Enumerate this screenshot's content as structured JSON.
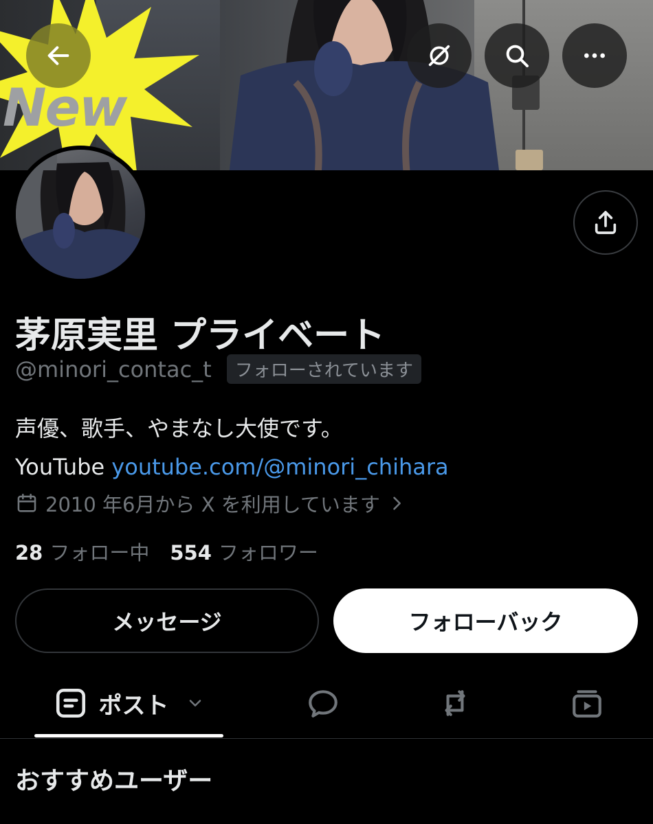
{
  "banner": {
    "sticker_text": "New"
  },
  "profile": {
    "name": "茅原実里 プライベート",
    "handle": "@minori_contac_t",
    "follows_you": "フォローされています",
    "bio_line1": "声優、歌手、やまなし大使です。",
    "bio_line2_prefix": "YouTube ",
    "bio_link": "youtube.com/@minori_chihara",
    "joined": "2010 年6月から X を利用しています",
    "following_count": "28",
    "following_label": "フォロー中",
    "followers_count": "554",
    "followers_label": "フォロワー"
  },
  "actions": {
    "message": "メッセージ",
    "follow_back": "フォローバック"
  },
  "tabs": {
    "posts_label": "ポスト"
  },
  "section": {
    "recommended": "おすすめユーザー"
  },
  "colors": {
    "link": "#4a99e9",
    "muted": "#71767b",
    "back_button": "#828228"
  }
}
